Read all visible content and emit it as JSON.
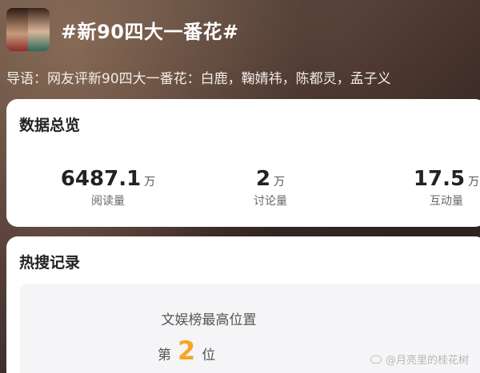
{
  "topic": {
    "title": "#新90四大一番花#",
    "intro": "导语：网友评新90四大一番花：白鹿，鞠婧祎，陈都灵，孟子义"
  },
  "overview": {
    "title": "数据总览",
    "stats": [
      {
        "value": "6487.1",
        "unit": "万",
        "label": "阅读量"
      },
      {
        "value": "2",
        "unit": "万",
        "label": "讨论量"
      },
      {
        "value": "17.5",
        "unit": "万",
        "label": "互动量"
      }
    ]
  },
  "hot_search": {
    "title": "热搜记录",
    "best_position_label": "文娱榜最高位置",
    "rank_prefix": "第",
    "rank_value": "2",
    "rank_suffix": "位"
  },
  "watermark": {
    "text": "@月亮里的桂花树",
    "icon": "chat-bubble-icon"
  },
  "colors": {
    "rank_accent": "#f5a623",
    "card_bg": "#ffffff",
    "inner_bg": "#f5f5f7"
  }
}
